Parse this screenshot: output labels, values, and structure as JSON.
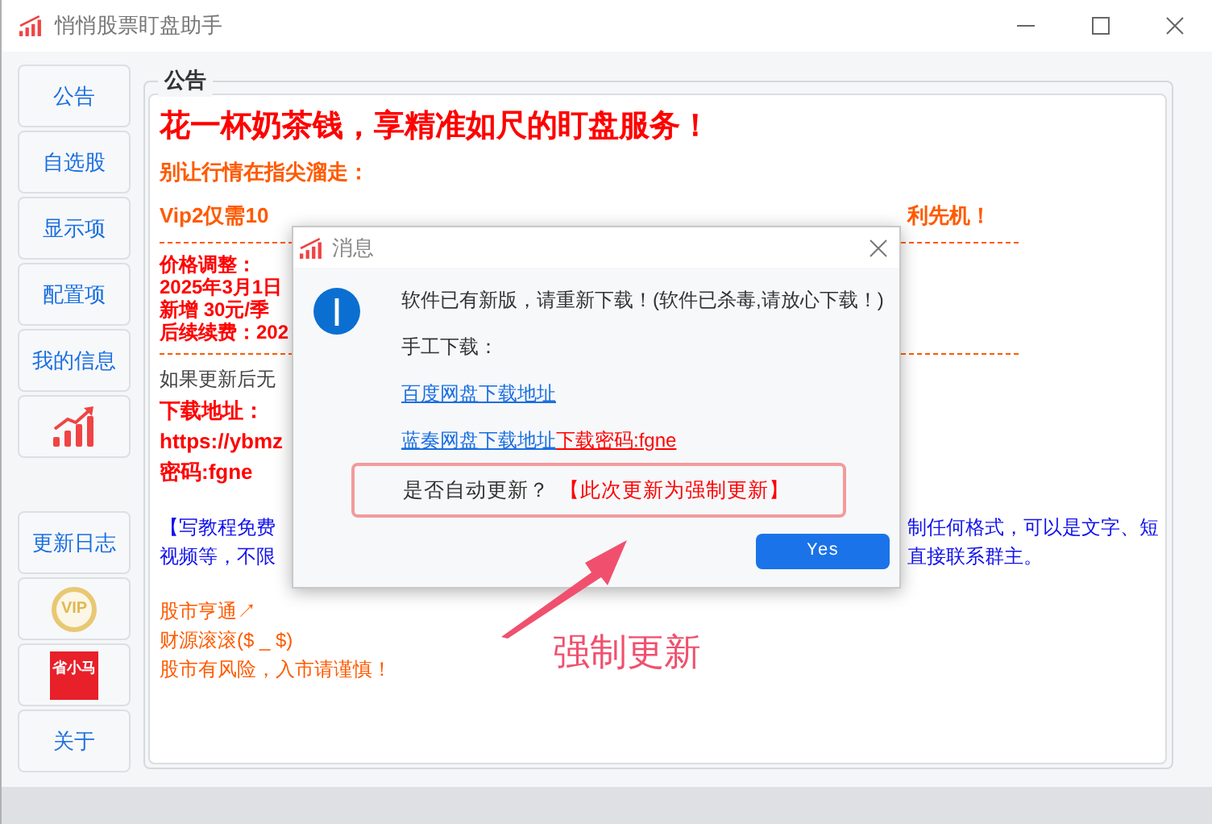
{
  "window": {
    "title": "悄悄股票盯盘助手"
  },
  "sidebar": {
    "items": [
      {
        "kind": "text",
        "label": "公告"
      },
      {
        "kind": "text",
        "label": "自选股"
      },
      {
        "kind": "text",
        "label": "显示项"
      },
      {
        "kind": "text",
        "label": "配置项"
      },
      {
        "kind": "text",
        "label": "我的信息"
      },
      {
        "kind": "chart"
      },
      {
        "kind": "gap"
      },
      {
        "kind": "text",
        "label": "更新日志"
      },
      {
        "kind": "vip",
        "label": "VIP"
      },
      {
        "kind": "logo",
        "label": "省小马"
      },
      {
        "kind": "text",
        "label": "关于"
      }
    ]
  },
  "notice": {
    "title": "公告",
    "blocks": [
      {
        "kind": "headline",
        "text": "花一杯奶茶钱，享精准如尺的盯盘服务！"
      },
      {
        "kind": "subhead",
        "text": "别让行情在指尖溜走："
      },
      {
        "kind": "promo",
        "text": "Vip2仅需10",
        "right": "利先机！"
      },
      {
        "kind": "divider"
      },
      {
        "kind": "price",
        "text": "价格调整："
      },
      {
        "kind": "price",
        "text": "2025年3月1日"
      },
      {
        "kind": "price",
        "text": "新增 30元/季"
      },
      {
        "kind": "price",
        "text": "后续续费：202"
      },
      {
        "kind": "divider"
      },
      {
        "kind": "plain",
        "text": "如果更新后无"
      },
      {
        "kind": "download",
        "text": "下载地址："
      },
      {
        "kind": "download",
        "text": "https://ybmz"
      },
      {
        "kind": "download",
        "text": "密码:fgne"
      },
      {
        "kind": "note",
        "text": "【写教程免费",
        "right": "制任何格式，可以是文字、短"
      },
      {
        "kind": "note",
        "text": "视频等，不限",
        "right": "直接联系群主。"
      },
      {
        "kind": "footer",
        "text": "股市亨通↗"
      },
      {
        "kind": "footer",
        "text": "财源滚滚($ _ $)"
      },
      {
        "kind": "footer",
        "text": "股市有风险，入市请谨慎！"
      }
    ]
  },
  "dialog": {
    "title": "消息",
    "message": "软件已有新版，请重新下载！(软件已杀毒,请放心下载！)",
    "manual_label": "手工下载：",
    "links": [
      {
        "text": "百度网盘下载地址"
      },
      {
        "text": "蓝奏网盘下载地址",
        "password": "下载密码:fgne"
      }
    ],
    "question": "是否自动更新？",
    "forced_note": "【此次更新为强制更新】",
    "button": "Yes"
  },
  "annotation": {
    "text": "强制更新"
  }
}
